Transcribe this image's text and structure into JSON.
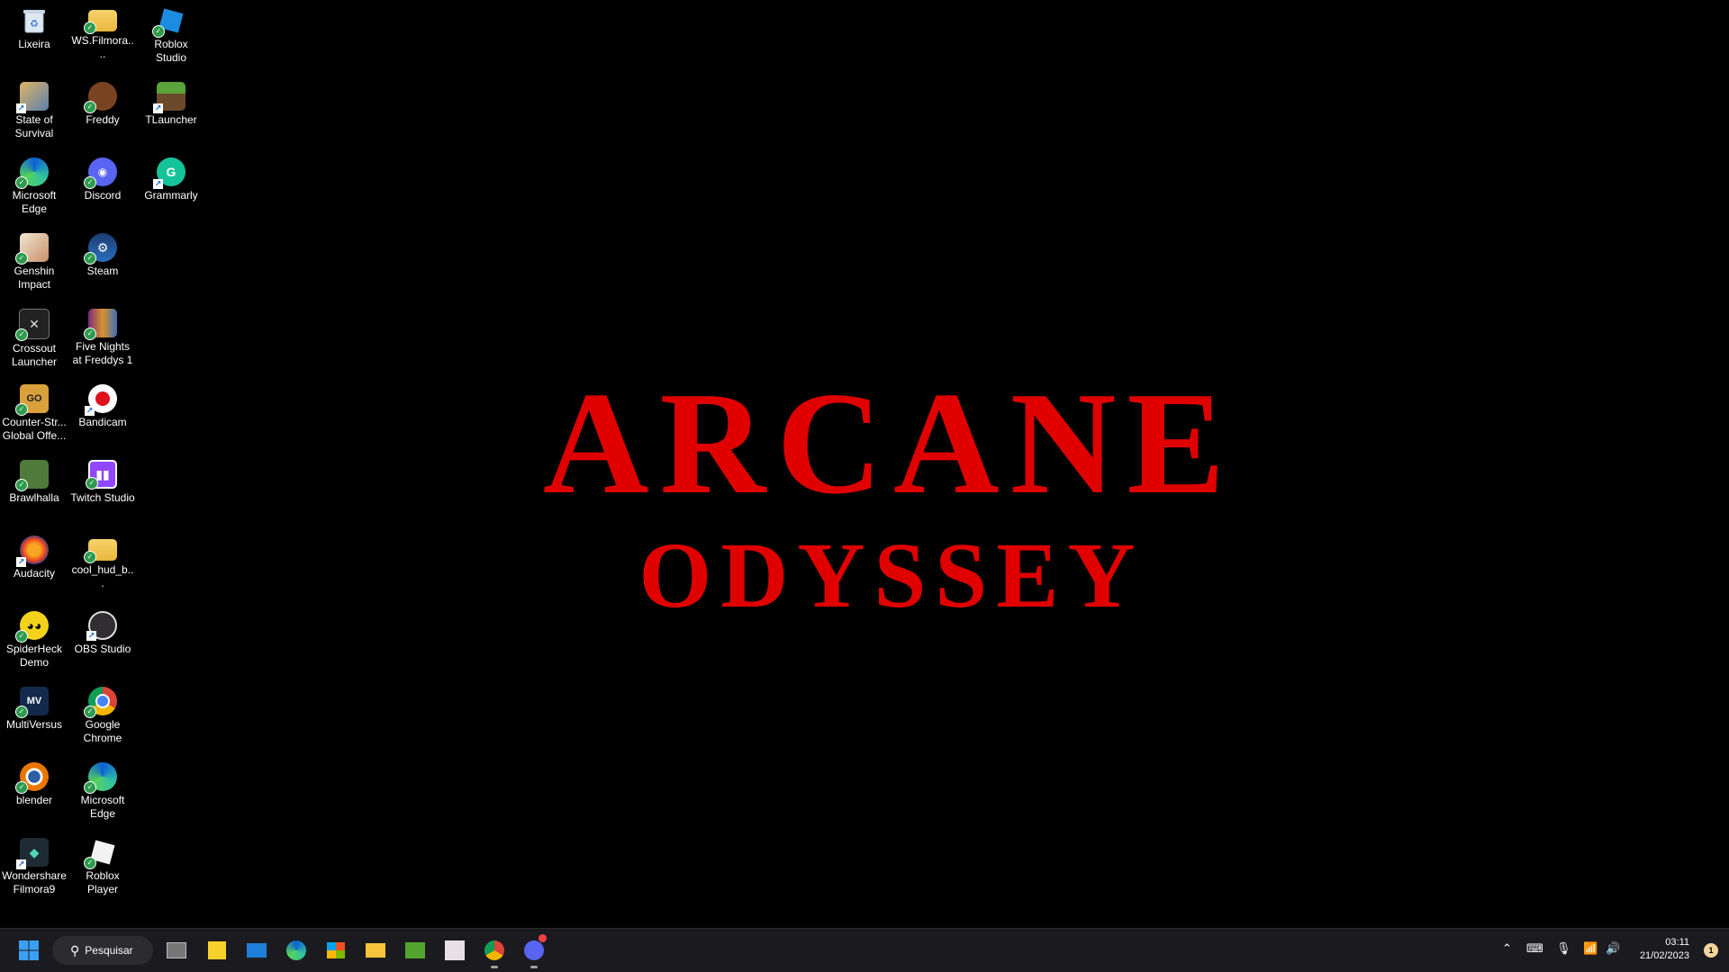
{
  "wallpaper": {
    "title_line1": "ARCANE",
    "title_line2": "ODYSSEY",
    "title_color": "#e00000"
  },
  "desktop_icons": [
    {
      "label": "Lixeira",
      "icon": "recycle-bin-icon"
    },
    {
      "label": "WS.Filmora....",
      "icon": "folder-icon"
    },
    {
      "label": "Roblox Studio",
      "icon": "roblox-studio-icon"
    },
    {
      "label": "State of Survival",
      "icon": "state-of-survival-icon"
    },
    {
      "label": "Freddy",
      "icon": "freddy-icon"
    },
    {
      "label": "TLauncher",
      "icon": "tlauncher-icon"
    },
    {
      "label": "Microsoft Edge",
      "icon": "edge-icon"
    },
    {
      "label": "Discord",
      "icon": "discord-icon"
    },
    {
      "label": "Grammarly",
      "icon": "grammarly-icon"
    },
    {
      "label": "Genshin Impact",
      "icon": "genshin-impact-icon"
    },
    {
      "label": "Steam",
      "icon": "steam-icon"
    },
    {
      "label": "Crossout Launcher",
      "icon": "crossout-icon"
    },
    {
      "label": "Five Nights at Freddys 1",
      "icon": "fnaf-icon"
    },
    {
      "label": "Counter-Str... Global Offe...",
      "icon": "csgo-icon"
    },
    {
      "label": "Bandicam",
      "icon": "bandicam-icon"
    },
    {
      "label": "Brawlhalla",
      "icon": "brawlhalla-icon"
    },
    {
      "label": "Twitch Studio",
      "icon": "twitch-studio-icon"
    },
    {
      "label": "Audacity",
      "icon": "audacity-icon"
    },
    {
      "label": "cool_hud_b...",
      "icon": "folder-icon"
    },
    {
      "label": "SpiderHeck Demo",
      "icon": "spiderheck-icon"
    },
    {
      "label": "OBS Studio",
      "icon": "obs-icon"
    },
    {
      "label": "MultiVersus",
      "icon": "multiversus-icon"
    },
    {
      "label": "Google Chrome",
      "icon": "chrome-icon"
    },
    {
      "label": "blender",
      "icon": "blender-icon"
    },
    {
      "label": "Microsoft Edge",
      "icon": "edge-icon"
    },
    {
      "label": "Wondershare Filmora9",
      "icon": "filmora-icon"
    },
    {
      "label": "Roblox Player",
      "icon": "roblox-icon"
    }
  ],
  "taskbar": {
    "search_label": "Pesquisar",
    "apps": [
      "task-view-icon",
      "sticky-notes-icon",
      "mail-icon",
      "edge-icon",
      "store-icon",
      "file-explorer-icon",
      "game-app-icon",
      "anime-app-icon",
      "chrome-icon",
      "discord-icon"
    ],
    "tray": {
      "time": "03:11",
      "date": "21/02/2023",
      "notification_count": "1"
    }
  }
}
